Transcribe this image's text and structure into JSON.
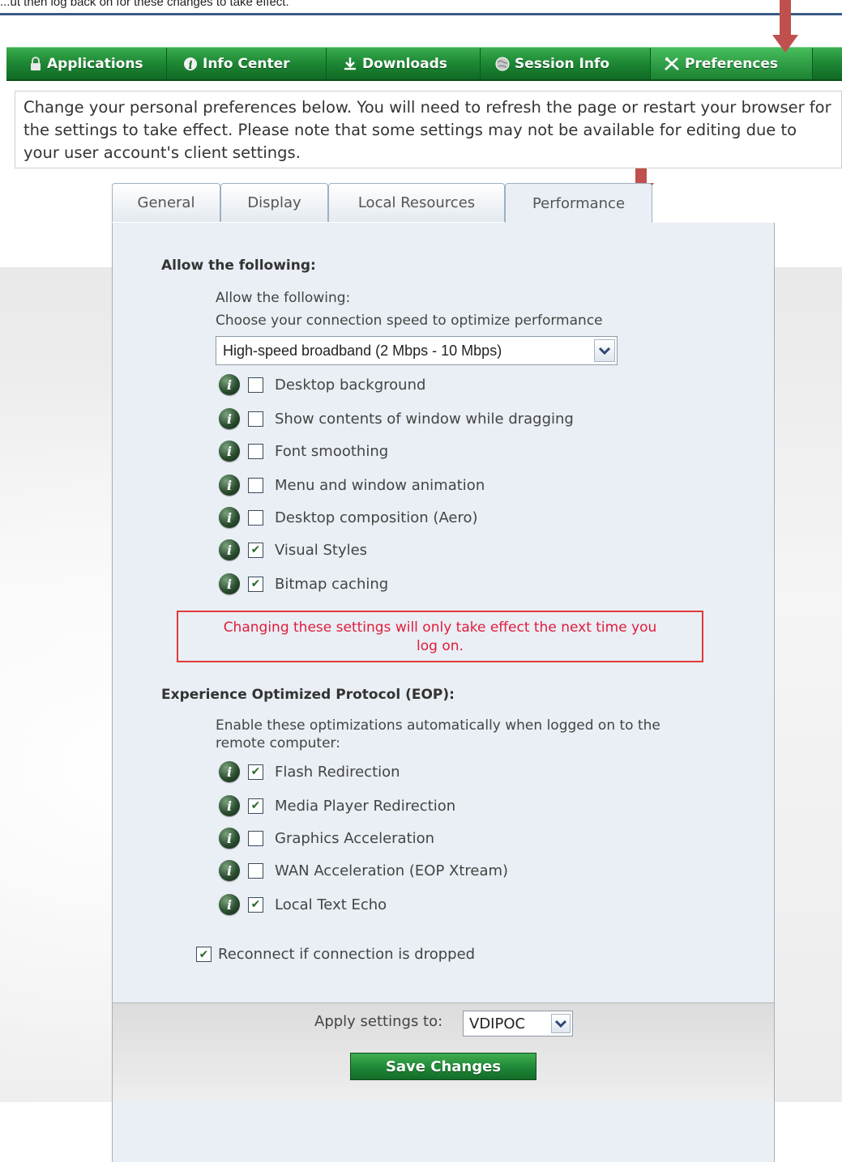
{
  "caption": "...ut then log back on for these changes to take effect.",
  "nav": {
    "items": [
      {
        "label": "Applications",
        "icon": "lock-icon"
      },
      {
        "label": "Info Center",
        "icon": "info-icon"
      },
      {
        "label": "Downloads",
        "icon": "download-icon"
      },
      {
        "label": "Session Info",
        "icon": "globe-icon"
      },
      {
        "label": "Preferences",
        "icon": "tools-icon",
        "active": true
      }
    ]
  },
  "intro": {
    "text": "Change your personal preferences below. You will need to refresh the page or restart your browser for the settings to take effect. Please note that some settings may not be available for editing due to your user account's client settings."
  },
  "tabs": [
    "General",
    "Display",
    "Local Resources",
    "Performance"
  ],
  "active_tab": "Performance",
  "performance": {
    "section1_heading": "Allow the following:",
    "sub_heading": "Allow the following:",
    "speed_prompt": "Choose your connection speed to optimize performance",
    "speed_value": "High-speed broadband (2 Mbps - 10 Mbps)",
    "options": [
      {
        "label": "Desktop background",
        "checked": false
      },
      {
        "label": "Show contents of window while dragging",
        "checked": false
      },
      {
        "label": "Font smoothing",
        "checked": false
      },
      {
        "label": "Menu and window animation",
        "checked": false
      },
      {
        "label": "Desktop composition (Aero)",
        "checked": false
      },
      {
        "label": "Visual Styles",
        "checked": true
      },
      {
        "label": "Bitmap caching",
        "checked": true
      }
    ],
    "warning_line1": "Changing these settings will only take effect the next time you",
    "warning_line2": "log on.",
    "eop_heading": "Experience Optimized Protocol (EOP):",
    "eop_intro_line1": "Enable these optimizations automatically when logged on to the",
    "eop_intro_line2": "remote computer:",
    "eop_options": [
      {
        "label": "Flash Redirection",
        "checked": true
      },
      {
        "label": "Media Player Redirection",
        "checked": true
      },
      {
        "label": "Graphics Acceleration",
        "checked": false
      },
      {
        "label": "WAN Acceleration (EOP Xtream)",
        "checked": false
      },
      {
        "label": "Local Text Echo",
        "checked": true
      }
    ],
    "reconnect_label": "Reconnect if connection is dropped",
    "reconnect_checked": true
  },
  "footer": {
    "apply_label": "Apply settings to:",
    "apply_value": "VDIPOC",
    "save_label": "Save Changes"
  },
  "colors": {
    "nav_green": "#1f8a36",
    "annotation_arrow": "#c0504d",
    "warning_red": "#e11b3c"
  }
}
